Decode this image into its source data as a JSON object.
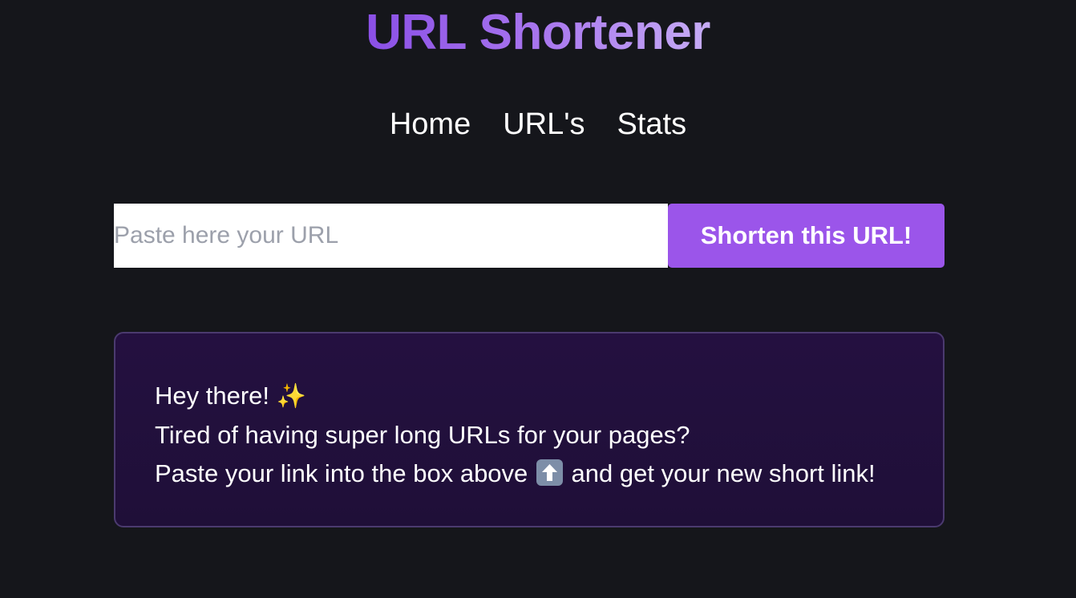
{
  "header": {
    "title": "URL Shortener"
  },
  "nav": {
    "items": [
      {
        "label": "Home"
      },
      {
        "label": "URL's"
      },
      {
        "label": "Stats"
      }
    ]
  },
  "form": {
    "input_value": "",
    "input_placeholder": "Paste here your URL",
    "button_label": "Shorten this URL!"
  },
  "info_card": {
    "line1": "Hey there!",
    "line2": "Tired of having super long URLs for your pages?",
    "line3_before": "Paste your link into the box above",
    "line3_after": "and get your new short link!",
    "icons": [
      "sparkles-icon",
      "up-arrow-icon"
    ]
  },
  "colors": {
    "background": "#15161b",
    "accent": "#9b55ea",
    "title_gradient_start": "#8a4fe6",
    "title_gradient_end": "#c6acf5",
    "card_background": "#241040",
    "card_border": "#4b3a6f"
  }
}
